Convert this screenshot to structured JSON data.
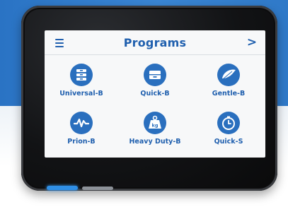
{
  "header": {
    "title": "Programs",
    "menu_icon": "hamburger-menu-icon",
    "next_icon": "chevron-right-icon",
    "next_glyph": ">"
  },
  "programs": [
    {
      "label": "Universal-B",
      "icon": "stacked-trays-icon"
    },
    {
      "label": "Quick-B",
      "icon": "single-tray-icon"
    },
    {
      "label": "Gentle-B",
      "icon": "feather-icon"
    },
    {
      "label": "Prion-B",
      "icon": "wave-icon"
    },
    {
      "label": "Heavy Duty-B",
      "icon": "weight-kg-icon"
    },
    {
      "label": "Quick-S",
      "icon": "timer-icon"
    }
  ],
  "icon_text": {
    "weight": "kg"
  },
  "colors": {
    "accent": "#1f5fae",
    "icon_fill": "#2a6fbe",
    "screen_bg": "#f7f8f9",
    "led_active": "#2f8fe6",
    "led_inactive": "#8d9299"
  },
  "indicators": {
    "active_index": 0,
    "count": 2
  }
}
